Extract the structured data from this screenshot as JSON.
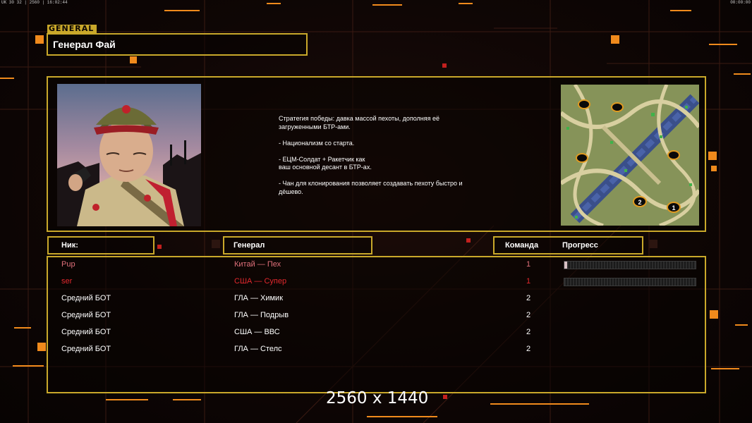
{
  "hud": {
    "left": "UK 30 32 | 2560 | 16:02:44",
    "right": "00:00:00"
  },
  "logo": "GENERAL",
  "general_name": "Генерал Фай",
  "description": [
    "Стратегия победы: давка массой пехоты, дополняя её\n загруженными БТР-ами.",
    "- Национализм со старта.",
    "- ЕЦМ-Солдат + Ракетчик как\nваш основной десант в БТР-ах.",
    "- Чан для клонирования позволяет создавать пехоту быстро и\n дёшево."
  ],
  "table_headers": {
    "nick": "Ник:",
    "general": "Генерал",
    "team": "Команда",
    "progress": "Прогресс"
  },
  "players": [
    {
      "nick": "Pup",
      "general": "Китай — Пех",
      "team": "1",
      "color": "#e0707a",
      "progress": 0.02
    },
    {
      "nick": "ser",
      "general": "США — Супер",
      "team": "1",
      "color": "#e3282d",
      "progress": 0.0
    },
    {
      "nick": "Средний БОТ",
      "general": "ГЛА — Химик",
      "team": "2",
      "color": "#ffffff"
    },
    {
      "nick": "Средний БОТ",
      "general": "ГЛА — Подрыв",
      "team": "2",
      "color": "#ffffff"
    },
    {
      "nick": "Средний БОТ",
      "general": "США — ВВС",
      "team": "2",
      "color": "#ffffff"
    },
    {
      "nick": "Средний БОТ",
      "general": "ГЛА — Стелс",
      "team": "2",
      "color": "#ffffff"
    }
  ],
  "map_markers": [
    "2",
    "1"
  ],
  "resolution_label": "2560 x 1440",
  "colors": {
    "frame": "#c9a82a",
    "accent_orange": "#f08a1c",
    "background": "#0b0504"
  }
}
